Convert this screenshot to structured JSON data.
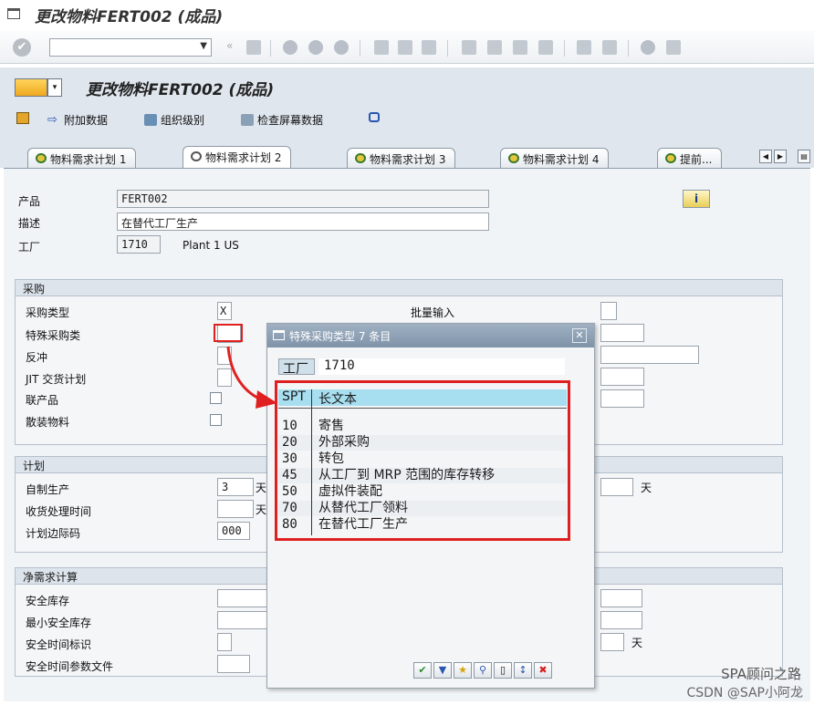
{
  "window": {
    "title": "更改物料FERT002 (成品)"
  },
  "toolbar": {
    "command_value": ""
  },
  "app": {
    "title": "更改物料FERT002 (成品)",
    "buttons": [
      "附加数据",
      "组织级别",
      "检查屏幕数据"
    ]
  },
  "tabs": [
    "物料需求计划 1",
    "物料需求计划 2",
    "物料需求计划 3",
    "物料需求计划 4",
    "提前..."
  ],
  "header": {
    "product_label": "产品",
    "product_value": "FERT002",
    "desc_label": "描述",
    "desc_value": "在替代工厂生产",
    "plant_label": "工厂",
    "plant_value": "1710",
    "plant_name": "Plant 1 US"
  },
  "procurement": {
    "title": "采购",
    "proc_type_label": "采购类型",
    "proc_type_value": "X",
    "special_label": "特殊采购类",
    "backflush_label": "反冲",
    "jit_label": "JIT 交货计划",
    "coproduct_label": "联产品",
    "bulk_label": "散装物料",
    "batch_entry_label": "批量输入"
  },
  "planning": {
    "title": "计划",
    "inhouse_label": "自制生产",
    "inhouse_value": "3",
    "gr_label": "收货处理时间",
    "margin_label": "计划边际码",
    "margin_value": "000",
    "unit_day": "天"
  },
  "netreq": {
    "title": "净需求计算",
    "safety_label": "安全库存",
    "min_safety_label": "最小安全库存",
    "safety_time_label": "安全时间标识",
    "safety_profile_label": "安全时间参数文件",
    "unit_day": "天"
  },
  "popup": {
    "title": "特殊采购类型 7 条目",
    "plant_label": "工厂",
    "plant_value": "1710",
    "col_code": "SPT",
    "col_text": "长文本",
    "rows": [
      {
        "code": "10",
        "text": "寄售"
      },
      {
        "code": "20",
        "text": "外部采购"
      },
      {
        "code": "30",
        "text": "转包"
      },
      {
        "code": "45",
        "text": "从工厂到 MRP 范围的库存转移"
      },
      {
        "code": "50",
        "text": "虚拟件装配"
      },
      {
        "code": "70",
        "text": "从替代工厂领料"
      },
      {
        "code": "80",
        "text": "在替代工厂生产"
      }
    ]
  },
  "watermark": {
    "line1": "SPA顾问之路",
    "line2": "CSDN @SAP小阿龙"
  },
  "colors": {
    "accent_red": "#e02020",
    "panel_bg": "#f1f4f7",
    "popup_head": "#7f93a9"
  }
}
